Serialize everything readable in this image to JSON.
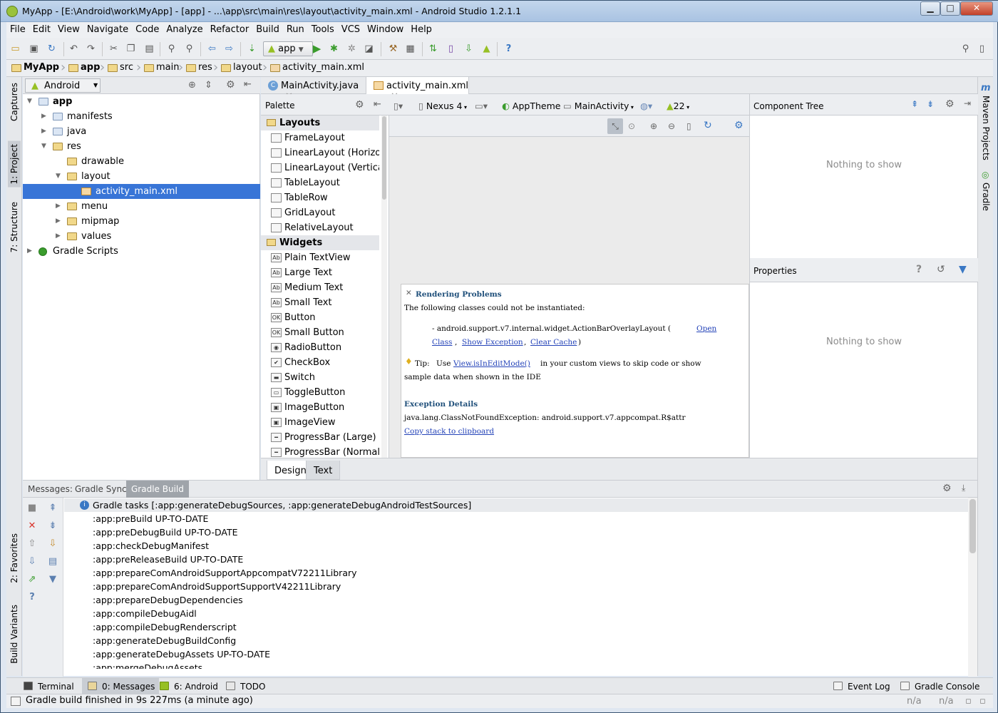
{
  "window": {
    "title": "MyApp - [E:\\Android\\work\\MyApp] - [app] - ...\\app\\src\\main\\res\\layout\\activity_main.xml - Android Studio 1.2.1.1",
    "buttons": {
      "minimize": "▁",
      "maximize": "□",
      "close": "✕"
    }
  },
  "menu": [
    "File",
    "Edit",
    "View",
    "Navigate",
    "Code",
    "Analyze",
    "Refactor",
    "Build",
    "Run",
    "Tools",
    "VCS",
    "Window",
    "Help"
  ],
  "toolbar": {
    "run_config": "app"
  },
  "breadcrumbs": [
    "MyApp",
    "app",
    "src",
    "main",
    "res",
    "layout",
    "activity_main.xml"
  ],
  "left_strip": {
    "captures": "Captures",
    "project": "1: Project",
    "structure": "7: Structure",
    "favorites": "2: Favorites",
    "build_variants": "Build Variants"
  },
  "right_strip": {
    "maven": "Maven Projects",
    "gradle": "Gradle"
  },
  "project": {
    "view_selector": "Android",
    "tree": [
      {
        "label": "app",
        "depth": 0,
        "expanded": true,
        "bold": true
      },
      {
        "label": "manifests",
        "depth": 1,
        "expanded": false
      },
      {
        "label": "java",
        "depth": 1,
        "expanded": false
      },
      {
        "label": "res",
        "depth": 1,
        "expanded": true
      },
      {
        "label": "drawable",
        "depth": 2,
        "leaf": true
      },
      {
        "label": "layout",
        "depth": 2,
        "expanded": true
      },
      {
        "label": "activity_main.xml",
        "depth": 3,
        "leaf": true,
        "selected": true
      },
      {
        "label": "menu",
        "depth": 2,
        "expanded": false
      },
      {
        "label": "mipmap",
        "depth": 2,
        "expanded": false
      },
      {
        "label": "values",
        "depth": 2,
        "expanded": false
      },
      {
        "label": "Gradle Scripts",
        "depth": 0,
        "expanded": false
      }
    ]
  },
  "editor_tabs": [
    {
      "label": "MainActivity.java",
      "active": false
    },
    {
      "label": "activity_main.xml",
      "active": true
    }
  ],
  "palette": {
    "title": "Palette",
    "rows": [
      {
        "label": "Layouts",
        "group": true
      },
      {
        "label": "FrameLayout"
      },
      {
        "label": "LinearLayout (Horizontal)"
      },
      {
        "label": "LinearLayout (Vertical)"
      },
      {
        "label": "TableLayout"
      },
      {
        "label": "TableRow"
      },
      {
        "label": "GridLayout"
      },
      {
        "label": "RelativeLayout"
      },
      {
        "label": "Widgets",
        "group": true
      },
      {
        "label": "Plain TextView",
        "icon": "Ab"
      },
      {
        "label": "Large Text",
        "icon": "Ab"
      },
      {
        "label": "Medium Text",
        "icon": "Ab"
      },
      {
        "label": "Small Text",
        "icon": "Ab"
      },
      {
        "label": "Button",
        "icon": "OK"
      },
      {
        "label": "Small Button",
        "icon": "OK"
      },
      {
        "label": "RadioButton",
        "icon": "◉"
      },
      {
        "label": "CheckBox",
        "icon": "✔"
      },
      {
        "label": "Switch",
        "icon": "▬"
      },
      {
        "label": "ToggleButton",
        "icon": "▭"
      },
      {
        "label": "ImageButton",
        "icon": "▣"
      },
      {
        "label": "ImageView",
        "icon": "▣"
      },
      {
        "label": "ProgressBar (Large)",
        "icon": "━"
      },
      {
        "label": "ProgressBar (Normal)",
        "icon": "━"
      }
    ]
  },
  "canvas_toolbar": {
    "device": "Nexus 4",
    "theme": "AppTheme",
    "activity": "MainActivity",
    "api": "22"
  },
  "rendering": {
    "title": "Rendering Problems",
    "line1": "The following classes could not be instantiated:",
    "class_name": "-  android.support.v7.internal.widget.ActionBarOverlayLayout (",
    "open_class_1": "Open",
    "open_class_2": "Class",
    "show_exception": "Show Exception",
    "clear_cache": "Clear Cache",
    "close_paren": ")",
    "comma": ",",
    "tip_label": "Tip:",
    "tip_use": "Use",
    "tip_link": "View.isInEditMode()",
    "tip_rest": "in your custom views to skip code or show",
    "tip_line2": "sample data when shown in the IDE",
    "exception_title": "Exception Details",
    "exception_text": "java.lang.ClassNotFoundException: android.support.v7.appcompat.R$attr",
    "copy_link": "Copy stack to clipboard"
  },
  "design_tabs": [
    "Design",
    "Text"
  ],
  "component_tree": {
    "title": "Component Tree",
    "empty": "Nothing to show"
  },
  "properties": {
    "title": "Properties",
    "empty": "Nothing to show"
  },
  "messages": {
    "label": "Messages:",
    "tabs": [
      {
        "label": "Gradle Sync",
        "active": false
      },
      {
        "label": "Gradle Build",
        "active": true
      }
    ],
    "header": "Gradle tasks [:app:generateDebugSources, :app:generateDebugAndroidTestSources]",
    "lines": [
      ":app:preBuild UP-TO-DATE",
      ":app:preDebugBuild UP-TO-DATE",
      ":app:checkDebugManifest",
      ":app:preReleaseBuild UP-TO-DATE",
      ":app:prepareComAndroidSupportAppcompatV72211Library",
      ":app:prepareComAndroidSupportSupportV42211Library",
      ":app:prepareDebugDependencies",
      ":app:compileDebugAidl",
      ":app:compileDebugRenderscript",
      ":app:generateDebugBuildConfig",
      ":app:generateDebugAssets UP-TO-DATE",
      ":app:mergeDebugAssets"
    ]
  },
  "bottom_tabs": [
    {
      "label": "Terminal",
      "active": false
    },
    {
      "label": "0: Messages",
      "active": true
    },
    {
      "label": "6: Android",
      "active": false
    },
    {
      "label": "TODO",
      "active": false
    },
    {
      "label": "Event Log",
      "active": false
    },
    {
      "label": "Gradle Console",
      "active": false
    }
  ],
  "status": {
    "text": "Gradle build finished in 9s 227ms (a minute ago)",
    "pos1": "n/a",
    "pos2": "n/a"
  },
  "colors": {
    "selection": "#3875d7",
    "link": "#2443b8",
    "run_green": "#3a9c2c",
    "android_green": "#97c024"
  }
}
